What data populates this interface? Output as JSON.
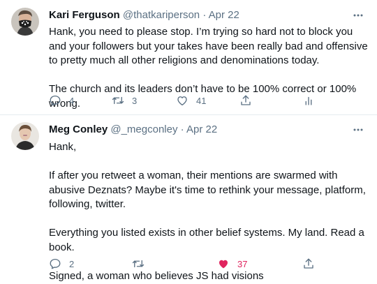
{
  "tweets": [
    {
      "name": "Kari Ferguson",
      "handle": "@thatkariperson",
      "separator": "·",
      "date": "Apr 22",
      "paragraphs": [
        "Hank, you need to please stop. I’m trying so hard not to block you and your followers but your takes have been really bad and offensive to pretty much all other religions and denominations today.",
        "The church and its leaders don’t have to be 100% correct or 100% wrong."
      ],
      "replies": "4",
      "retweets": "3",
      "likes": "41"
    },
    {
      "name": "Meg Conley",
      "handle": "@_megconley",
      "separator": "·",
      "date": "Apr 22",
      "paragraphs": [
        "Hank,",
        "If after you retweet a woman, their mentions are swarmed with abusive Deznats? Maybe it's time to rethink your message, platform, following, twitter.",
        "Everything you listed exists in other belief systems. My land. Read a book.",
        "Signed, a woman who believes JS had visions"
      ],
      "replies": "2",
      "retweets": "",
      "likes": "37"
    }
  ],
  "colors": {
    "text": "#0f1419",
    "secondary": "#5b7083",
    "like_active": "#e0245e",
    "divider": "#e6ecf0"
  },
  "icons": [
    "more-icon",
    "reply-icon",
    "retweet-icon",
    "like-icon",
    "share-icon",
    "analytics-icon"
  ]
}
